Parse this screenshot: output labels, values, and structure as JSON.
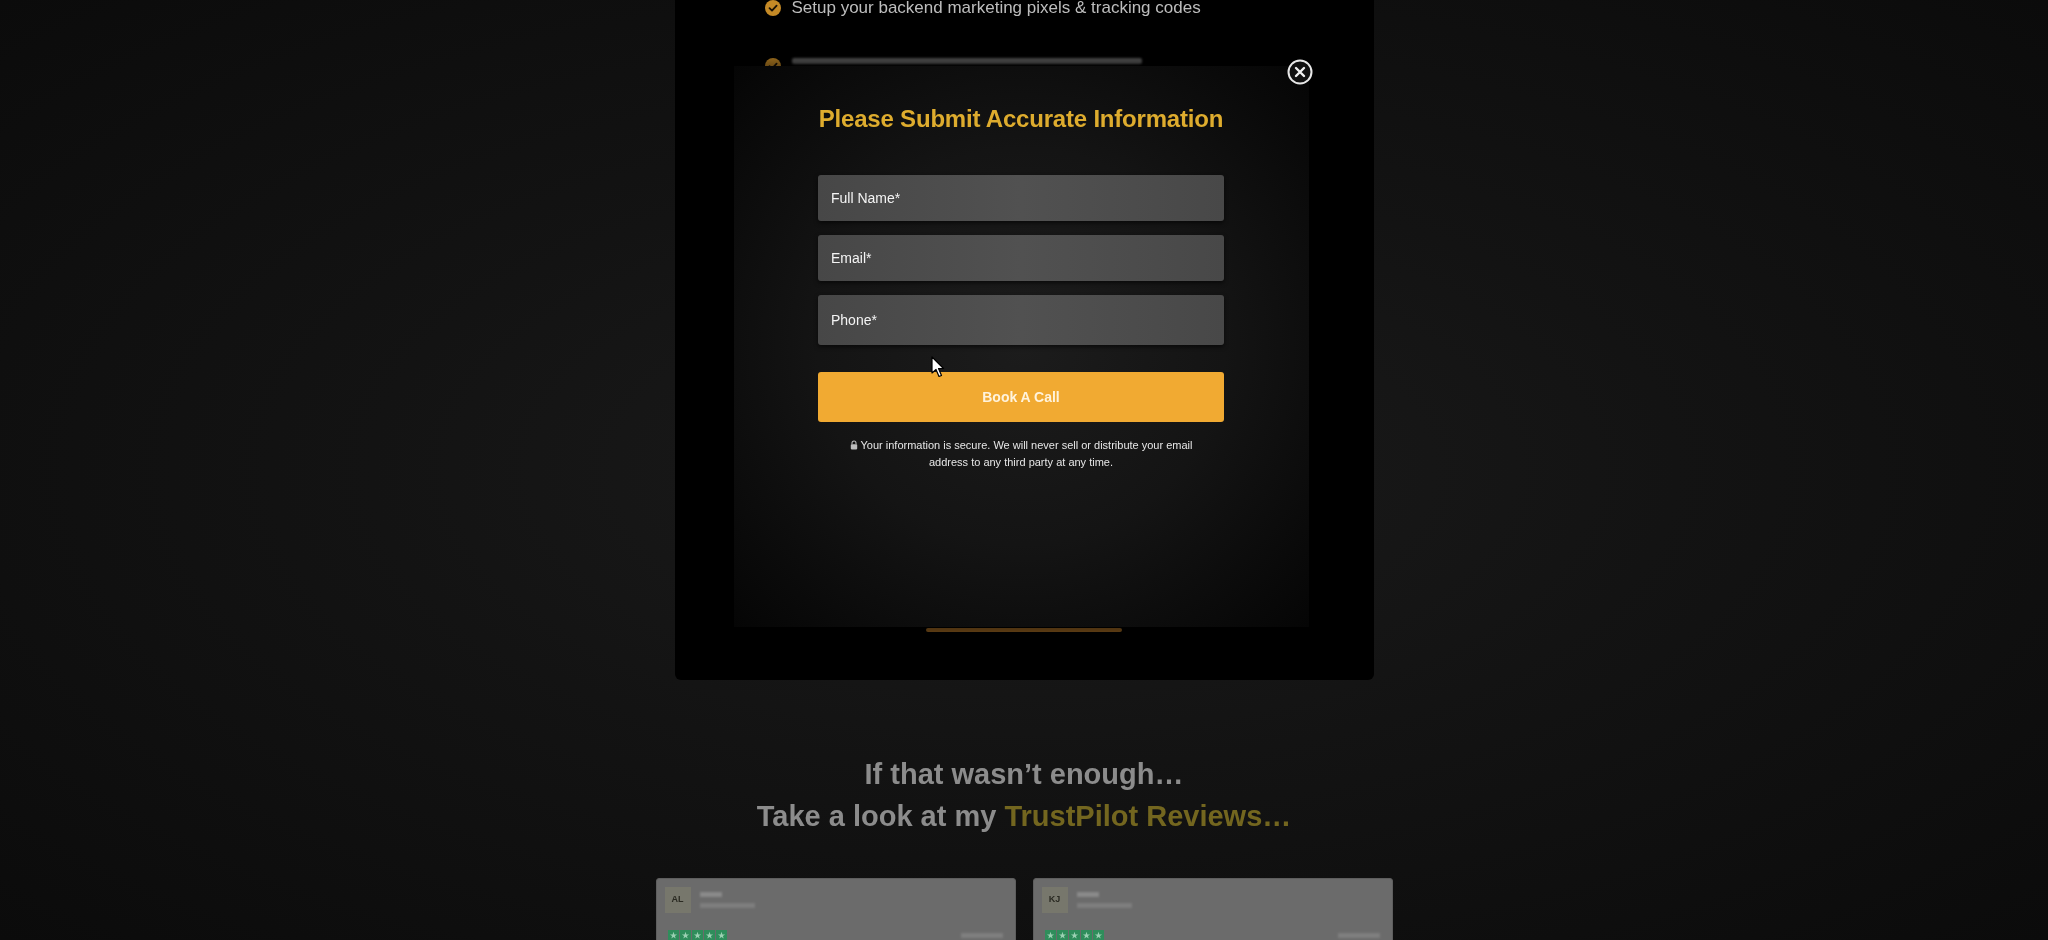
{
  "checklist": [
    {
      "kind": "text",
      "text": "Setup your backend marketing pixels & tracking codes"
    },
    {
      "kind": "obscured"
    }
  ],
  "modal": {
    "title": "Please Submit Accurate Information",
    "fields": [
      {
        "placeholder": "Full Name*"
      },
      {
        "placeholder": "Email*"
      },
      {
        "placeholder": "Phone*"
      }
    ],
    "submit_button": "Book A Call",
    "privacy_note": "Your information is secure. We will never sell or distribute your email address to any third party at any time."
  },
  "reviews_heading": {
    "line_1": "If that wasn’t enough…",
    "line_2": "Take a look at my",
    "highlight": "TrustPilot Reviews…"
  },
  "reviews": [
    {
      "initials": "AL",
      "stars": 5
    },
    {
      "initials": "KJ",
      "stars": 5
    }
  ]
}
